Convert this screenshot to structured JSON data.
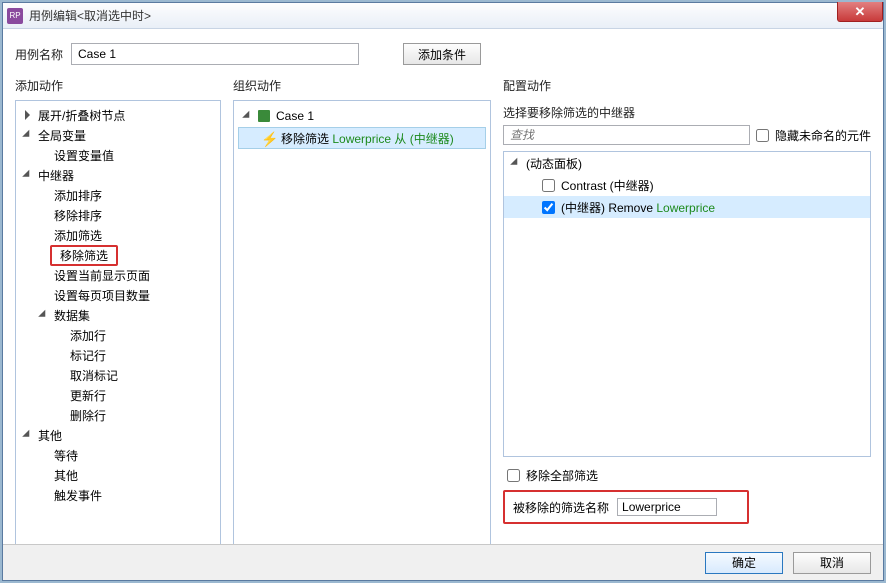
{
  "window": {
    "title": "用例编辑<取消选中时>"
  },
  "header": {
    "name_label": "用例名称",
    "name_value": "Case 1",
    "add_condition": "添加条件"
  },
  "columns": {
    "add_action": "添加动作",
    "organize": "组织动作",
    "configure": "配置动作"
  },
  "tree": {
    "expand_collapse": "展开/折叠树节点",
    "global_var": "全局变量",
    "set_var": "设置变量值",
    "repeater": "中继器",
    "add_sort": "添加排序",
    "remove_sort": "移除排序",
    "add_filter": "添加筛选",
    "remove_filter": "移除筛选",
    "set_page": "设置当前显示页面",
    "set_perpage": "设置每页项目数量",
    "dataset": "数据集",
    "add_row": "添加行",
    "mark_row": "标记行",
    "unmark_row": "取消标记",
    "update_row": "更新行",
    "delete_row": "删除行",
    "other": "其他",
    "wait": "等待",
    "other2": "其他",
    "fire_event": "触发事件"
  },
  "organize": {
    "case_label": "Case 1",
    "action_prefix": "移除筛选 ",
    "action_link": "Lowerprice 从 (中继器)"
  },
  "configure": {
    "select_label": "选择要移除筛选的中继器",
    "search_placeholder": "查找",
    "hide_unnamed": "隐藏未命名的元件",
    "dynamic_panel": "(动态面板)",
    "contrast": "Contrast (中继器)",
    "repeater_prefix": "(中继器) Remove ",
    "repeater_link": "Lowerprice",
    "remove_all": "移除全部筛选",
    "removed_name_label": "被移除的筛选名称",
    "removed_name_value": "Lowerprice"
  },
  "footer": {
    "ok": "确定",
    "cancel": "取消"
  }
}
